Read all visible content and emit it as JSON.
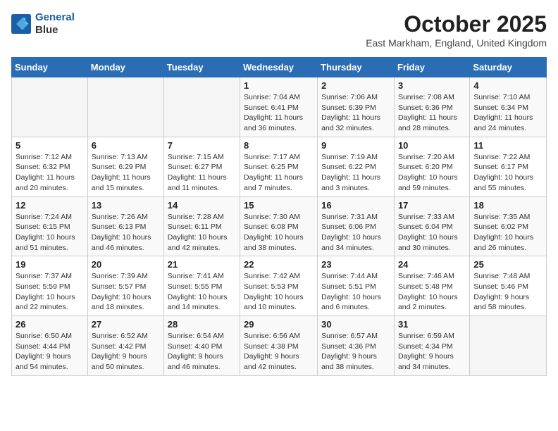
{
  "header": {
    "logo_line1": "General",
    "logo_line2": "Blue",
    "month": "October 2025",
    "location": "East Markham, England, United Kingdom"
  },
  "days_of_week": [
    "Sunday",
    "Monday",
    "Tuesday",
    "Wednesday",
    "Thursday",
    "Friday",
    "Saturday"
  ],
  "weeks": [
    [
      {
        "day": "",
        "info": ""
      },
      {
        "day": "",
        "info": ""
      },
      {
        "day": "",
        "info": ""
      },
      {
        "day": "1",
        "info": "Sunrise: 7:04 AM\nSunset: 6:41 PM\nDaylight: 11 hours and 36 minutes."
      },
      {
        "day": "2",
        "info": "Sunrise: 7:06 AM\nSunset: 6:39 PM\nDaylight: 11 hours and 32 minutes."
      },
      {
        "day": "3",
        "info": "Sunrise: 7:08 AM\nSunset: 6:36 PM\nDaylight: 11 hours and 28 minutes."
      },
      {
        "day": "4",
        "info": "Sunrise: 7:10 AM\nSunset: 6:34 PM\nDaylight: 11 hours and 24 minutes."
      }
    ],
    [
      {
        "day": "5",
        "info": "Sunrise: 7:12 AM\nSunset: 6:32 PM\nDaylight: 11 hours and 20 minutes."
      },
      {
        "day": "6",
        "info": "Sunrise: 7:13 AM\nSunset: 6:29 PM\nDaylight: 11 hours and 15 minutes."
      },
      {
        "day": "7",
        "info": "Sunrise: 7:15 AM\nSunset: 6:27 PM\nDaylight: 11 hours and 11 minutes."
      },
      {
        "day": "8",
        "info": "Sunrise: 7:17 AM\nSunset: 6:25 PM\nDaylight: 11 hours and 7 minutes."
      },
      {
        "day": "9",
        "info": "Sunrise: 7:19 AM\nSunset: 6:22 PM\nDaylight: 11 hours and 3 minutes."
      },
      {
        "day": "10",
        "info": "Sunrise: 7:20 AM\nSunset: 6:20 PM\nDaylight: 10 hours and 59 minutes."
      },
      {
        "day": "11",
        "info": "Sunrise: 7:22 AM\nSunset: 6:17 PM\nDaylight: 10 hours and 55 minutes."
      }
    ],
    [
      {
        "day": "12",
        "info": "Sunrise: 7:24 AM\nSunset: 6:15 PM\nDaylight: 10 hours and 51 minutes."
      },
      {
        "day": "13",
        "info": "Sunrise: 7:26 AM\nSunset: 6:13 PM\nDaylight: 10 hours and 46 minutes."
      },
      {
        "day": "14",
        "info": "Sunrise: 7:28 AM\nSunset: 6:11 PM\nDaylight: 10 hours and 42 minutes."
      },
      {
        "day": "15",
        "info": "Sunrise: 7:30 AM\nSunset: 6:08 PM\nDaylight: 10 hours and 38 minutes."
      },
      {
        "day": "16",
        "info": "Sunrise: 7:31 AM\nSunset: 6:06 PM\nDaylight: 10 hours and 34 minutes."
      },
      {
        "day": "17",
        "info": "Sunrise: 7:33 AM\nSunset: 6:04 PM\nDaylight: 10 hours and 30 minutes."
      },
      {
        "day": "18",
        "info": "Sunrise: 7:35 AM\nSunset: 6:02 PM\nDaylight: 10 hours and 26 minutes."
      }
    ],
    [
      {
        "day": "19",
        "info": "Sunrise: 7:37 AM\nSunset: 5:59 PM\nDaylight: 10 hours and 22 minutes."
      },
      {
        "day": "20",
        "info": "Sunrise: 7:39 AM\nSunset: 5:57 PM\nDaylight: 10 hours and 18 minutes."
      },
      {
        "day": "21",
        "info": "Sunrise: 7:41 AM\nSunset: 5:55 PM\nDaylight: 10 hours and 14 minutes."
      },
      {
        "day": "22",
        "info": "Sunrise: 7:42 AM\nSunset: 5:53 PM\nDaylight: 10 hours and 10 minutes."
      },
      {
        "day": "23",
        "info": "Sunrise: 7:44 AM\nSunset: 5:51 PM\nDaylight: 10 hours and 6 minutes."
      },
      {
        "day": "24",
        "info": "Sunrise: 7:46 AM\nSunset: 5:48 PM\nDaylight: 10 hours and 2 minutes."
      },
      {
        "day": "25",
        "info": "Sunrise: 7:48 AM\nSunset: 5:46 PM\nDaylight: 9 hours and 58 minutes."
      }
    ],
    [
      {
        "day": "26",
        "info": "Sunrise: 6:50 AM\nSunset: 4:44 PM\nDaylight: 9 hours and 54 minutes."
      },
      {
        "day": "27",
        "info": "Sunrise: 6:52 AM\nSunset: 4:42 PM\nDaylight: 9 hours and 50 minutes."
      },
      {
        "day": "28",
        "info": "Sunrise: 6:54 AM\nSunset: 4:40 PM\nDaylight: 9 hours and 46 minutes."
      },
      {
        "day": "29",
        "info": "Sunrise: 6:56 AM\nSunset: 4:38 PM\nDaylight: 9 hours and 42 minutes."
      },
      {
        "day": "30",
        "info": "Sunrise: 6:57 AM\nSunset: 4:36 PM\nDaylight: 9 hours and 38 minutes."
      },
      {
        "day": "31",
        "info": "Sunrise: 6:59 AM\nSunset: 4:34 PM\nDaylight: 9 hours and 34 minutes."
      },
      {
        "day": "",
        "info": ""
      }
    ]
  ]
}
